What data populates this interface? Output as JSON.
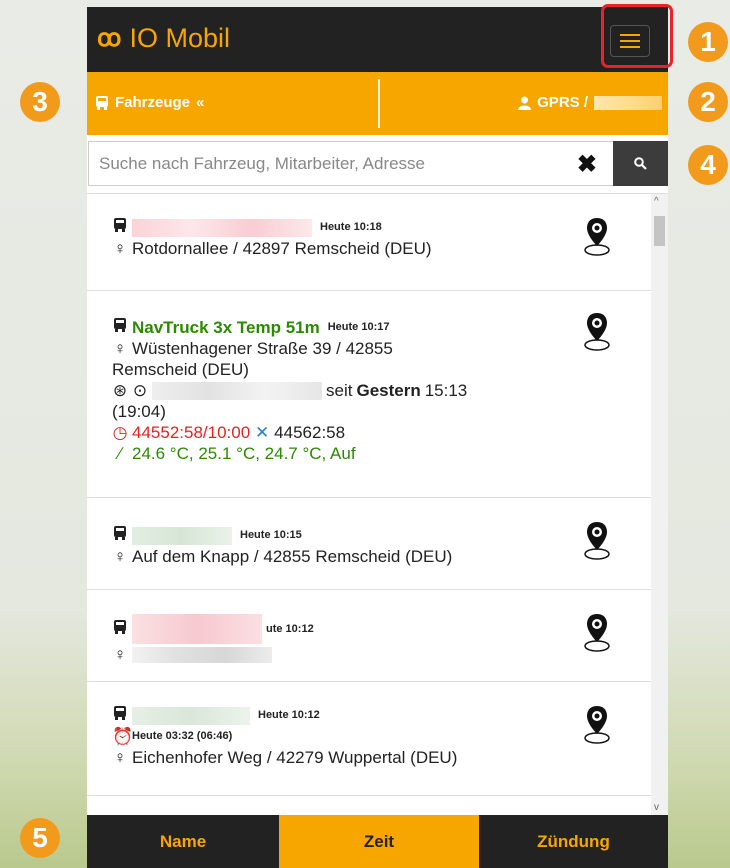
{
  "app": {
    "title": "IO Mobil"
  },
  "filter_bar": {
    "left_label": "Fahrzeuge",
    "right_label": "GPRS /"
  },
  "search": {
    "placeholder": "Suche nach Fahrzeug, Mitarbeiter, Adresse",
    "value": ""
  },
  "vehicles": [
    {
      "name": "",
      "time": "Heute 10:18",
      "address": "Rotdornallee / 42897 Remscheid (DEU)"
    },
    {
      "name": "NavTruck 3x Temp 51m",
      "time": "Heute 10:17",
      "address_line1": "Wüstenhagener Straße 39 / 42855",
      "address_line2": "Remscheid (DEU)",
      "driver_since_prefix": "seit",
      "driver_since_day": "Gestern",
      "driver_since_time": "15:13",
      "driver_duration": "(19:04)",
      "service_red": "44552:58/10:00",
      "service_blue": "44562:58",
      "temperatures": "24.6 °C, 25.1 °C, 24.7 °C, Auf"
    },
    {
      "name": "",
      "time": "Heute 10:15",
      "address": "Auf dem Knapp / 42855 Remscheid (DEU)"
    },
    {
      "name": "",
      "time": "ute 10:12"
    },
    {
      "name": "",
      "time": "Heute 10:12",
      "alarm_time": "Heute 03:32 (06:46)",
      "address": "Eichenhofer Weg / 42279 Wuppertal (DEU)"
    }
  ],
  "bottom_tabs": [
    "Name",
    "Zeit",
    "Zündung"
  ],
  "badges": [
    "1",
    "2",
    "3",
    "4",
    "5"
  ],
  "colors": {
    "accent": "#f7a600",
    "dark": "#222222",
    "badge": "#f29a1c",
    "highlight": "#e8232b",
    "green": "#2a8a00",
    "red": "#e52222",
    "blue": "#2a7fd4"
  }
}
